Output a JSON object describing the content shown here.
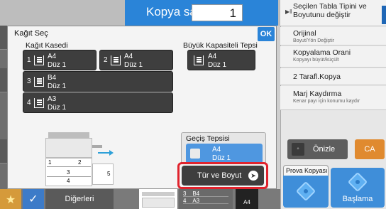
{
  "header": {
    "copies_label": "Kopya sayısı",
    "copies_value": "1"
  },
  "dialog": {
    "title": "Kağıt Seç",
    "ok_label": "OK",
    "cassette_label": "Kağıt Kasedi",
    "lcc_label": "Büyük Kapasiteli Tepsi",
    "bypass_label": "Geçiş Tepsisi",
    "trays": [
      {
        "num": "1",
        "size": "A4",
        "type": "Düz 1"
      },
      {
        "num": "2",
        "size": "A4",
        "type": "Düz 1"
      },
      {
        "num": "3",
        "size": "B4",
        "type": "Düz 1"
      },
      {
        "num": "4",
        "size": "A3",
        "type": "Düz 1"
      }
    ],
    "lcc": {
      "size": "A4",
      "type": "Düz 1"
    },
    "bypass": {
      "size": "A4",
      "type": "Düz 1"
    },
    "type_size_label": "Tür ve Boyut",
    "illustration": {
      "trays": [
        "1",
        "2",
        "3",
        "4",
        "5"
      ]
    }
  },
  "right_panel": {
    "items": [
      {
        "title": "Seçilen Tabla Tipini ve Boyutunu değiştir",
        "sub": ""
      },
      {
        "title": "Orijinal",
        "sub": "Boyut/Yön Değiştir"
      },
      {
        "title": "Kopyalama Orani",
        "sub": "Kopyayı büyüt/küçült"
      },
      {
        "title": "2 Tarafl.Kopya",
        "sub": ""
      },
      {
        "title": "Marj Kaydırma",
        "sub": "Kenar payı için konumu kaydır"
      }
    ],
    "preview_label": "Önizle",
    "ca_label": "CA",
    "proof_label": "Prova Kopyası",
    "start_label": "Başlama"
  },
  "bottom": {
    "others_label": "Diğerleri",
    "mini_trays": [
      {
        "num": "3",
        "size": "B4"
      },
      {
        "num": "4",
        "size": "A3"
      }
    ],
    "thumb_label": "A4"
  }
}
